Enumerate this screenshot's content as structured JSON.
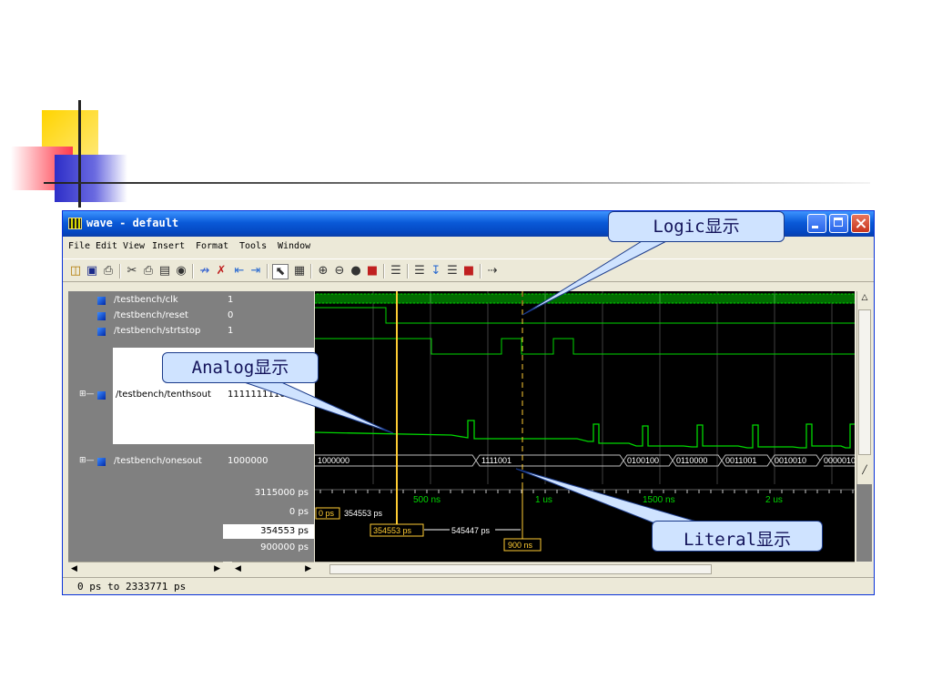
{
  "window": {
    "title": "wave - default",
    "menu": [
      "File",
      "Edit",
      "View",
      "Insert",
      "Format",
      "Tools",
      "Window"
    ],
    "status": "0 ps to 2333771 ps"
  },
  "toolbar": {
    "icons": [
      "open-icon",
      "save-icon",
      "print-icon",
      "cut-icon",
      "copy-icon",
      "paste-icon",
      "find-icon",
      "add-wave-icon",
      "delete-icon",
      "insert-cursor-icon",
      "delete-cursor-icon",
      "select-mode-icon",
      "zoom-mode-icon",
      "zoom-in-icon",
      "zoom-out-icon",
      "zoom-full-icon",
      "zoom-range-icon",
      "find-edge-icon",
      "prev-edge-icon",
      "next-edge-icon",
      "stop-icon",
      "break-icon"
    ]
  },
  "signals": [
    {
      "name": "/testbench/clk",
      "value": "1"
    },
    {
      "name": "/testbench/reset",
      "value": "0"
    },
    {
      "name": "/testbench/strtstop",
      "value": "1"
    },
    {
      "name": "/testbench/tenthsout",
      "value": "1111111110"
    },
    {
      "name": "/testbench/onesout",
      "value": "1000000"
    }
  ],
  "onesout_bus": [
    "1000000",
    "1111001",
    "0100100",
    "0110000",
    "0011001",
    "0010010",
    "0000010"
  ],
  "timeline": {
    "now": "3115000 ps",
    "ticks": [
      "500 ns",
      "1 us",
      "1500 ns",
      "2 us"
    ]
  },
  "cursors": [
    {
      "label": "0 ps",
      "value": "0 ps",
      "value_box": "0 ps",
      "time_text": "354553 ps"
    },
    {
      "label": "354553 ps",
      "value": "354553 ps",
      "value_box": "354553 ps",
      "delta": "545447 ps"
    },
    {
      "label": "900000 ps",
      "value": "900000 ps",
      "value_box": "900 ns"
    }
  ],
  "callouts": {
    "logic": "Logic显示",
    "analog": "Analog显示",
    "literal": "Literal显示"
  },
  "colors": {
    "wave": "#00d800",
    "cursor": "#ffcc33",
    "titlebar": "#0a5ad8",
    "callout_fill": "#cfe3ff"
  }
}
